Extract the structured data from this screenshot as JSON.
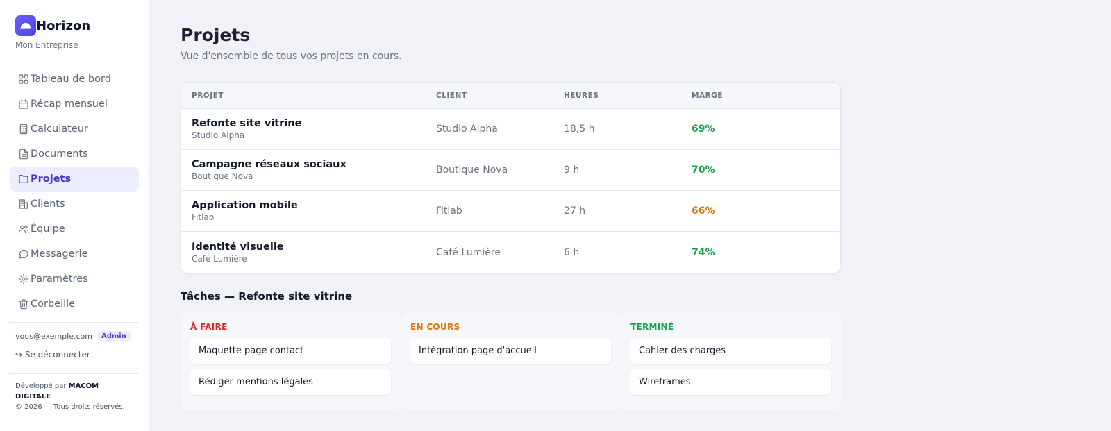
{
  "brand": {
    "name": "Horizon",
    "company": "Mon Entreprise"
  },
  "nav": [
    {
      "label": "Tableau de bord",
      "icon": "dashboard-icon"
    },
    {
      "label": "Récap mensuel",
      "icon": "calendar-icon"
    },
    {
      "label": "Calculateur",
      "icon": "calculator-icon"
    },
    {
      "label": "Documents",
      "icon": "document-icon"
    },
    {
      "label": "Projets",
      "icon": "folder-icon",
      "active": true
    },
    {
      "label": "Clients",
      "icon": "building-icon"
    },
    {
      "label": "Équipe",
      "icon": "users-icon"
    },
    {
      "label": "Messagerie",
      "icon": "message-icon"
    },
    {
      "label": "Paramètres",
      "icon": "gear-icon"
    },
    {
      "label": "Corbeille",
      "icon": "trash-icon"
    }
  ],
  "user": {
    "email": "vous@exemple.com",
    "role": "Admin",
    "logout": "↪ Se déconnecter"
  },
  "footer": {
    "dev_prefix": "Développé par ",
    "dev_name": "MACOM DIGITALE",
    "copyright": "© 2026 — Tous droits réservés."
  },
  "page": {
    "title": "Projets",
    "subtitle": "Vue d'ensemble de tous vos projets en cours."
  },
  "table": {
    "headers": [
      "PROJET",
      "CLIENT",
      "HEURES",
      "MARGE"
    ],
    "rows": [
      {
        "name": "Refonte site vitrine",
        "client_sub": "Studio Alpha",
        "client": "Studio Alpha",
        "hours": "18,5 h",
        "margin": "69%",
        "margin_color": "#16a34a"
      },
      {
        "name": "Campagne réseaux sociaux",
        "client_sub": "Boutique Nova",
        "client": "Boutique Nova",
        "hours": "9 h",
        "margin": "70%",
        "margin_color": "#16a34a"
      },
      {
        "name": "Application mobile",
        "client_sub": "Fitlab",
        "client": "Fitlab",
        "hours": "27 h",
        "margin": "66%",
        "margin_color": "#d97706"
      },
      {
        "name": "Identité visuelle",
        "client_sub": "Café Lumière",
        "client": "Café Lumière",
        "hours": "6 h",
        "margin": "74%",
        "margin_color": "#16a34a"
      }
    ]
  },
  "tasks": {
    "title": "Tâches — Refonte site vitrine",
    "columns": [
      {
        "title": "À FAIRE",
        "color": "#dc2626",
        "items": [
          "Maquette page contact",
          "Rédiger mentions légales"
        ]
      },
      {
        "title": "EN COURS",
        "color": "#d97706",
        "items": [
          "Intégration page d'accueil"
        ]
      },
      {
        "title": "TERMINÉ",
        "color": "#16a34a",
        "items": [
          "Cahier des charges",
          "Wireframes"
        ]
      }
    ]
  }
}
